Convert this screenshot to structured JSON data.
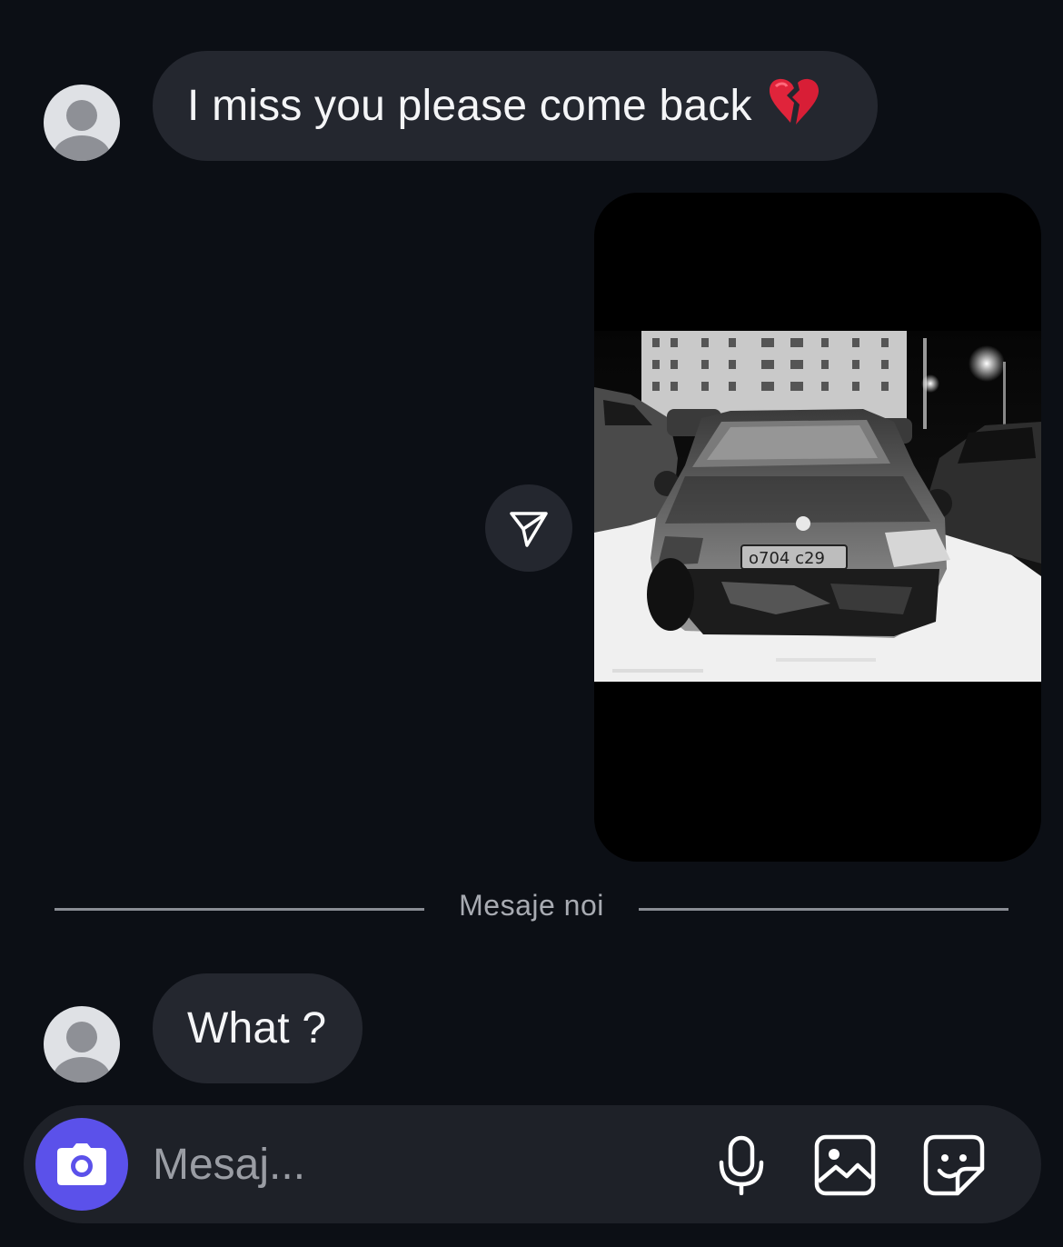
{
  "thread": {
    "messages": [
      {
        "sender": "other",
        "type": "text",
        "text": "I miss you please come back",
        "emoji": "broken-heart-emoji"
      },
      {
        "sender": "self",
        "type": "media",
        "media": "photo of damaged black car in snowy parking lot"
      }
    ],
    "new_messages_divider": "Mesaje noi",
    "after_divider": [
      {
        "sender": "other",
        "type": "text",
        "text": "What ?"
      }
    ]
  },
  "composer": {
    "placeholder": "Mesaj..."
  },
  "icons": {
    "camera": "camera-icon",
    "microphone": "microphone-icon",
    "gallery": "image-icon",
    "sticker": "sticker-icon",
    "share": "send-icon",
    "avatar": "default-avatar-icon"
  },
  "colors": {
    "background": "#0c0f15",
    "bubble": "#24272f",
    "accent": "#5b51ea",
    "divider": "#8a8d94"
  }
}
